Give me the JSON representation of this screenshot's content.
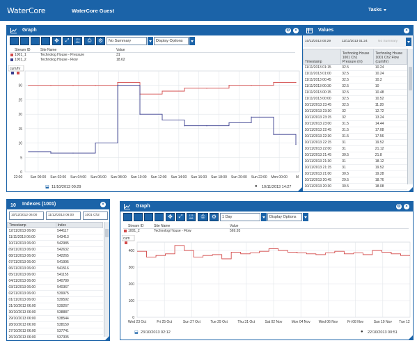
{
  "app": {
    "logo_text": "WaterCore",
    "title": "WaterCore Guest",
    "tasks_label": "Tasks",
    "brand_color": "#1b63a8"
  },
  "graph1": {
    "title": "Graph",
    "toolbar": {
      "summary_value": "No Summary",
      "display_options_label": "Display Options",
      "icon_text": "123\n456"
    },
    "legend": {
      "headers": {
        "stream_id": "Stream ID",
        "site_name": "Site Name",
        "value": "Value"
      },
      "rows": [
        {
          "id": "1001_1",
          "site": "Technolog House - Pressure",
          "value": "31",
          "color": "#d34a4a"
        },
        {
          "id": "1001_2",
          "site": "Technolog House - Flow",
          "value": "18.62",
          "color": "#3a3f8f"
        }
      ]
    },
    "axis_badge": "cum/hr",
    "start_time": "11/10/2013 00:29",
    "end_time": "10/11/2013 14:27",
    "chart_data": {
      "type": "line",
      "x": [
        "Sun 00:00",
        "Sun 02:00",
        "Sun 04:00",
        "Sun 06:00",
        "Sun 08:00",
        "Sun 10:00",
        "Sun 12:00",
        "Sun 14:00",
        "Sun 16:00",
        "Sun 18:00",
        "Sun 20:00",
        "Sun 22:00",
        "Mon 00:00"
      ],
      "x_tick_labels": [
        "22:00",
        "Sun 00:00",
        "Sun 02:00",
        "Sun 04:00",
        "Sun 06:00",
        "Sun 08:00",
        "Sun 10:00",
        "Sun 12:00",
        "Sun 14:00",
        "Sun 16:00",
        "Sun 18:00",
        "Sun 20:00",
        "Sun 22:00",
        "Mon 00:00",
        "M"
      ],
      "ylim": [
        0,
        35
      ],
      "y_ticks": [
        0,
        5,
        10,
        15,
        20,
        25,
        30
      ],
      "series": [
        {
          "name": "Technolog House - Pressure",
          "color": "#d34a4a",
          "values": [
            30,
            30,
            30,
            30,
            31,
            27,
            28,
            29,
            29,
            30,
            30,
            31,
            31
          ]
        },
        {
          "name": "Technolog House - Flow",
          "color": "#3a3f8f",
          "values": [
            7,
            6.5,
            6.5,
            10,
            30,
            20,
            18,
            16,
            16,
            17,
            19,
            13,
            9.5
          ]
        }
      ],
      "grid": true
    }
  },
  "values_panel": {
    "title": "Values",
    "from": "10/11/2013 00:29",
    "to": "11/11/2013 01:24",
    "summary": "No Summary",
    "headers": {
      "timestamp": "Timestamp",
      "col1": "Technolog House 1001 Ch1 Pressure (m)",
      "col2": "Technolog House 1001 Ch2 Flow (cum/hr)"
    },
    "rows": [
      [
        "11/11/2013 01:15",
        "32.5",
        "10.24"
      ],
      [
        "11/11/2013 01:00",
        "32.5",
        "10.24"
      ],
      [
        "11/11/2013 00:45",
        "32.5",
        "10.2"
      ],
      [
        "11/11/2013 00:30",
        "32.5",
        "10"
      ],
      [
        "11/11/2013 00:15",
        "32.5",
        "10.48"
      ],
      [
        "11/11/2013 00:00",
        "32.5",
        "10.52"
      ],
      [
        "10/11/2013 23:45",
        "32.5",
        "11.28"
      ],
      [
        "10/11/2013 23:30",
        "32",
        "12.72"
      ],
      [
        "10/11/2013 23:15",
        "32",
        "13.24"
      ],
      [
        "10/11/2013 23:00",
        "31.5",
        "14.44"
      ],
      [
        "10/11/2013 22:45",
        "31.5",
        "17.08"
      ],
      [
        "10/11/2013 22:30",
        "31.5",
        "17.56"
      ],
      [
        "10/11/2013 22:15",
        "31",
        "19.52"
      ],
      [
        "10/11/2013 22:00",
        "31",
        "21.12"
      ],
      [
        "10/11/2013 21:45",
        "30.5",
        "21.8"
      ],
      [
        "10/11/2013 21:30",
        "31",
        "18.12"
      ],
      [
        "10/11/2013 21:15",
        "31",
        "19.52"
      ],
      [
        "10/11/2013 21:00",
        "30.5",
        "19.28"
      ],
      [
        "10/11/2013 20:45",
        "29.5",
        "18.76"
      ],
      [
        "10/11/2013 20:30",
        "30.5",
        "18.08"
      ]
    ]
  },
  "indexes_panel": {
    "title": "Indexes (1001)",
    "from": "10/12/2012 06:00",
    "to": "11/12/2013 06:00",
    "channel": "1001 Ch2",
    "headers": {
      "timestamp": "Timestamp",
      "index": "Index"
    },
    "rows": [
      [
        "12/11/2013 06:00",
        "544117"
      ],
      [
        "11/11/2013 06:00",
        "543413"
      ],
      [
        "10/11/2013 06:00",
        "542985"
      ],
      [
        "09/11/2013 06:00",
        "542632"
      ],
      [
        "08/11/2013 06:00",
        "542265"
      ],
      [
        "07/11/2013 06:00",
        "541995"
      ],
      [
        "06/11/2013 06:00",
        "541516"
      ],
      [
        "05/11/2013 06:00",
        "541155"
      ],
      [
        "04/11/2013 06:00",
        "540780"
      ],
      [
        "03/11/2013 06:00",
        "540367"
      ],
      [
        "02/11/2013 06:00",
        "539975"
      ],
      [
        "01/11/2013 06:00",
        "539592"
      ],
      [
        "31/10/2013 06:00",
        "539267"
      ],
      [
        "30/10/2013 06:00",
        "538887"
      ],
      [
        "29/10/2013 06:00",
        "538544"
      ],
      [
        "28/10/2013 06:00",
        "538159"
      ],
      [
        "27/10/2013 06:00",
        "537741"
      ],
      [
        "26/10/2013 06:00",
        "537305"
      ]
    ]
  },
  "graph2": {
    "title": "Graph",
    "toolbar": {
      "summary_value": "1 Day",
      "display_options_label": "Display Options",
      "icon_text": "123\n456"
    },
    "legend": {
      "headers": {
        "stream_id": "Stream ID",
        "site_name": "Site Name",
        "value": "Value"
      },
      "rows": [
        {
          "id": "1001_2",
          "site": "Technolog House - Flow",
          "value": "569.93",
          "color": "#d34a4a"
        }
      ]
    },
    "axis_badge": "cum",
    "start_time": "23/10/2013 02:12",
    "end_time": "22/10/2013 00:51",
    "chart_data": {
      "type": "line",
      "step": true,
      "x_tick_labels": [
        "Wed 23 Oct",
        "Fri 25 Oct",
        "Sun 27 Oct",
        "Tue 29 Oct",
        "Thu 31 Oct",
        "Sat 02 Nov",
        "Mon 04 Nov",
        "Wed 06 Nov",
        "Fri 08 Nov",
        "Sun 10 Nov",
        "Tue 12"
      ],
      "ylim": [
        0,
        450
      ],
      "y_ticks": [
        0,
        100,
        200,
        300,
        400
      ],
      "series": [
        {
          "name": "Technolog House - Flow",
          "color": "#d34a4a",
          "values": [
            395,
            360,
            370,
            380,
            430,
            400,
            360,
            370,
            375,
            350,
            390,
            380,
            385,
            395,
            410,
            400,
            390,
            385,
            380,
            375,
            385,
            395,
            380,
            385,
            375,
            400,
            390,
            380,
            370
          ]
        }
      ],
      "grid": true
    }
  }
}
